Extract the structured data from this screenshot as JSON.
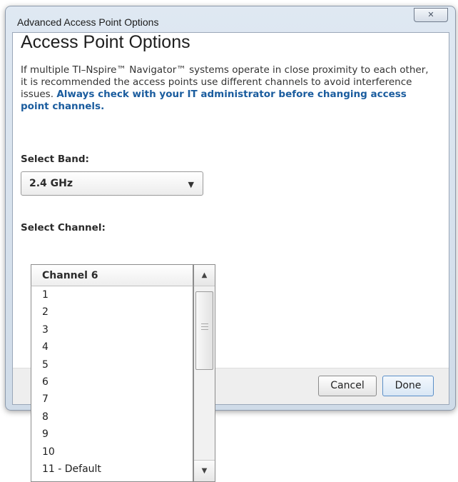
{
  "window": {
    "title": "Advanced Access Point Options",
    "close_glyph": "✕"
  },
  "dialog": {
    "heading": "Access Point Options",
    "description": "If multiple TI–Nspire™ Navigator™ systems operate in close proximity to each other, it is recommended the access points use different channels to avoid interference issues.",
    "warning": "Always check with your IT administrator before changing access point channels."
  },
  "band": {
    "label": "Select Band:",
    "selected": "2.4 GHz"
  },
  "channel": {
    "label": "Select Channel:",
    "selected": "Channel 6",
    "options": [
      "1",
      "2",
      "3",
      "4",
      "5",
      "6",
      "7",
      "8",
      "9",
      "10",
      "11 - Default"
    ]
  },
  "footer": {
    "cancel_label": "Cancel",
    "done_label": "Done"
  },
  "icons": {
    "close": "close-icon",
    "band_dropdown": "chevron-down-icon",
    "scroll_up": "scroll-up-icon",
    "scroll_down": "scroll-down-icon"
  },
  "colors": {
    "warning_text": "#1a5c9e",
    "primary_button_border": "#5a8ec7"
  }
}
